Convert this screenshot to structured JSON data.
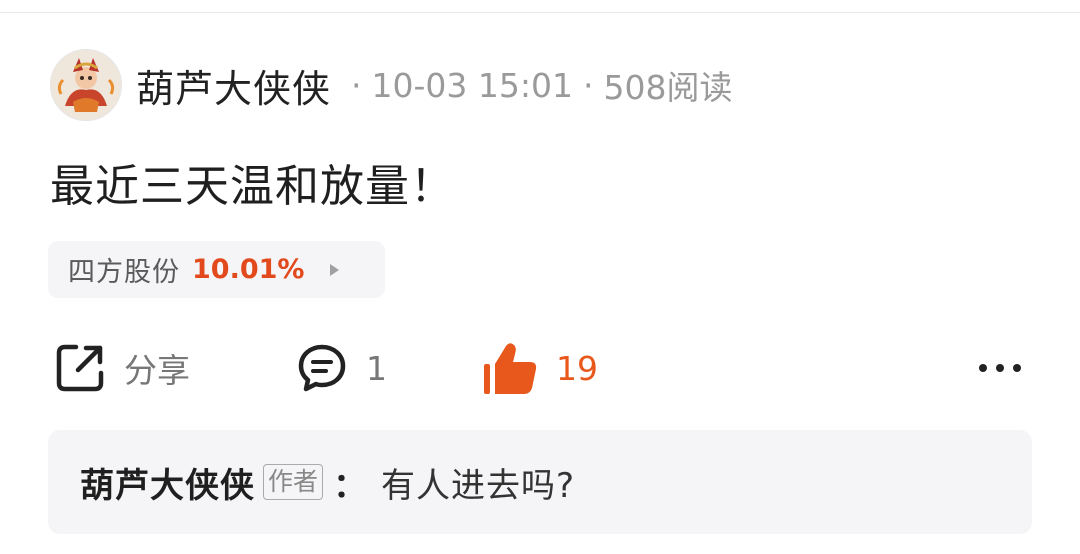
{
  "post": {
    "author": "葫芦大侠侠",
    "separator": "·",
    "time": "10-03 15:01",
    "reads": "508阅读",
    "content": "最近三天温和放量！"
  },
  "stock_tag": {
    "name": "四方股份",
    "change": "10.01%",
    "change_color": "#e24a1d"
  },
  "actions": {
    "share_label": "分享",
    "comment_count": "1",
    "like_count": "19",
    "accent_color": "#e8581c"
  },
  "reply": {
    "author": "葫芦大侠侠",
    "badge": "作者",
    "colon": "：",
    "text": "有人进去吗?"
  },
  "icons": {
    "share": "share-icon",
    "comment": "comment-icon",
    "like": "thumbs-up-icon",
    "more": "more-icon"
  }
}
